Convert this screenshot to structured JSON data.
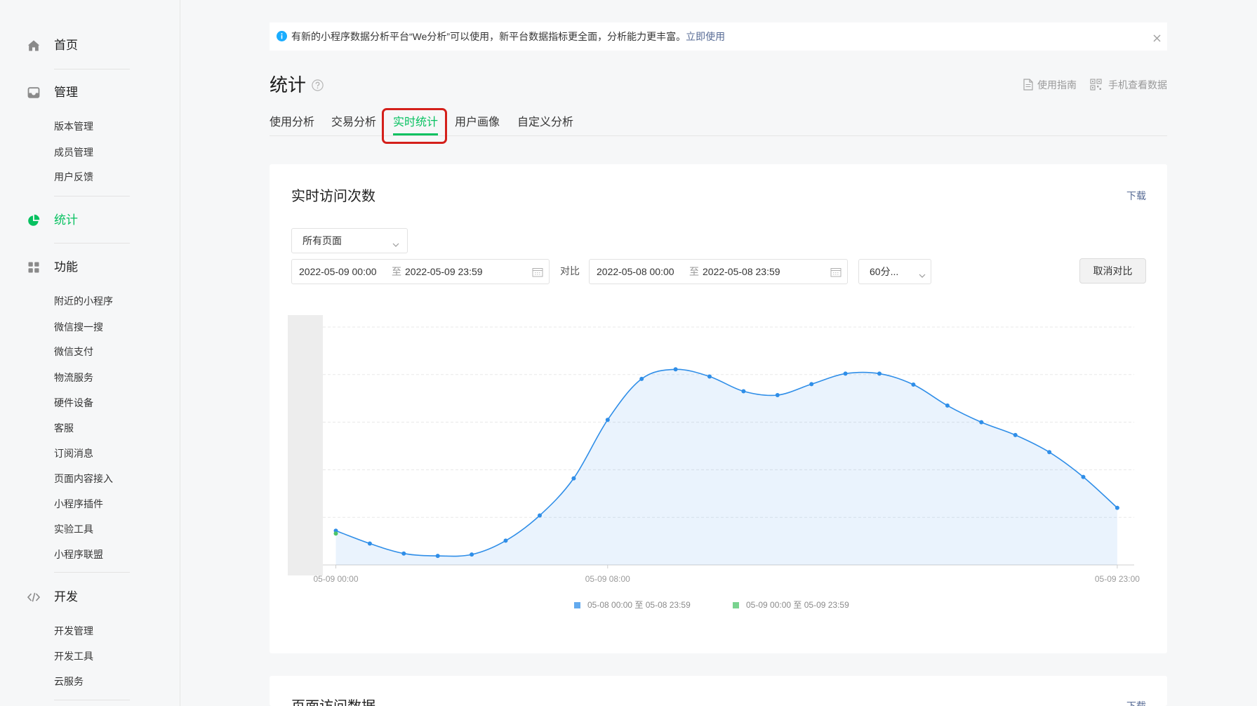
{
  "sidebar": {
    "home": {
      "label": "首页",
      "icon": "home-icon"
    },
    "manage": {
      "label": "管理",
      "icon": "inbox-icon",
      "items": [
        "版本管理",
        "成员管理",
        "用户反馈"
      ]
    },
    "stats": {
      "label": "统计",
      "icon": "pie-chart-icon",
      "active": true
    },
    "features": {
      "label": "功能",
      "icon": "grid-icon",
      "items": [
        "附近的小程序",
        "微信搜一搜",
        "微信支付",
        "物流服务",
        "硬件设备",
        "客服",
        "订阅消息",
        "页面内容接入",
        "小程序插件",
        "实验工具",
        "小程序联盟"
      ]
    },
    "dev": {
      "label": "开发",
      "icon": "code-icon",
      "items": [
        "开发管理",
        "开发工具",
        "云服务"
      ]
    }
  },
  "notice": {
    "icon": "info-icon",
    "text": "有新的小程序数据分析平台“We分析”可以使用，新平台数据指标更全面，分析能力更丰富。",
    "link": "立即使用",
    "close_icon": "close-icon"
  },
  "header": {
    "title": "统计",
    "help_icon": "help-icon",
    "guide": {
      "icon": "document-icon",
      "label": "使用指南"
    },
    "mobile": {
      "icon": "qr-code-icon",
      "label": "手机查看数据"
    }
  },
  "tabs": {
    "items": [
      "使用分析",
      "交易分析",
      "实时统计",
      "用户画像",
      "自定义分析"
    ],
    "active_index": 2
  },
  "realtime_card": {
    "title": "实时访问次数",
    "download": "下载",
    "page_select": "所有页面",
    "range_current": {
      "start": "2022-05-09 00:00",
      "separator": "至",
      "end": "2022-05-09 23:59"
    },
    "compare_label": "对比",
    "range_compare": {
      "start": "2022-05-08 00:00",
      "separator": "至",
      "end": "2022-05-08 23:59"
    },
    "interval": "60分...",
    "cancel_compare": "取消对比"
  },
  "page_visits_card": {
    "title": "页面访问数据",
    "download": "下载"
  },
  "colors": {
    "accent": "#07c160",
    "link": "#576b95",
    "info": "#1aadff",
    "highlight": "#d4201b"
  },
  "chart_data": {
    "type": "area",
    "x": [
      "05-09 00:00",
      "05-09 01:00",
      "05-09 02:00",
      "05-09 03:00",
      "05-09 04:00",
      "05-09 05:00",
      "05-09 06:00",
      "05-09 07:00",
      "05-09 08:00",
      "05-09 09:00",
      "05-09 10:00",
      "05-09 11:00",
      "05-09 12:00",
      "05-09 13:00",
      "05-09 14:00",
      "05-09 15:00",
      "05-09 16:00",
      "05-09 17:00",
      "05-09 18:00",
      "05-09 19:00",
      "05-09 20:00",
      "05-09 21:00",
      "05-09 22:00",
      "05-09 23:00"
    ],
    "xticks": [
      "05-09 00:00",
      "05-09 08:00",
      "05-09 23:00"
    ],
    "ylim": [
      0,
      5
    ],
    "grid": true,
    "legend": "bottom",
    "series": [
      {
        "name": "05-08 00:00 至 05-08 23:59",
        "color": "#2f8ee8",
        "values": [
          0.72,
          0.45,
          0.24,
          0.19,
          0.22,
          0.51,
          1.04,
          1.82,
          3.05,
          3.91,
          4.11,
          3.96,
          3.65,
          3.57,
          3.8,
          4.02,
          4.02,
          3.79,
          3.35,
          3.0,
          2.73,
          2.37,
          1.85,
          1.2
        ]
      },
      {
        "name": "05-09 00:00 至 05-09 23:59",
        "color": "#4cc46a",
        "values": [
          0.66
        ]
      }
    ]
  }
}
